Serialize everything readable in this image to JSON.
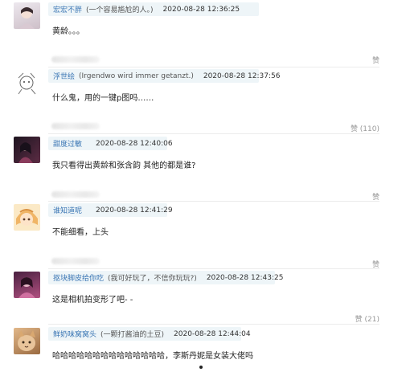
{
  "comments": [
    {
      "username": "宏宏不胖",
      "status": "(一个容易尴尬的人。)",
      "time": "2020-08-28 12:36:25",
      "text": "黄龄。。。",
      "likes": "赞",
      "avatar_colors": [
        "#e9e4ea",
        "#c9b9c2"
      ]
    },
    {
      "username": "浮世绘",
      "status": "(Irgendwo wird immer getanzt.)",
      "time": "2020-08-28 12:37:56",
      "text": "什么鬼，用的一键p图吗……",
      "likes": "赞 (110)",
      "avatar_colors": [
        "#ffffff",
        "#555555"
      ]
    },
    {
      "username": "甜度过敏",
      "status": "",
      "time": "2020-08-28 12:40:06",
      "text": "我只看得出黄龄和张含韵 其他的都是谁?",
      "likes": "赞",
      "avatar_colors": [
        "#2a1e28",
        "#7a3c55"
      ]
    },
    {
      "username": "谁知道呢",
      "status": "",
      "time": "2020-08-28 12:41:29",
      "text": "不能细看，上头",
      "likes": "赞",
      "avatar_colors": [
        "#f3d9a4",
        "#c98a5a"
      ]
    },
    {
      "username": "抠块脚皮给你吃",
      "status": "(我可好玩了，不信你玩玩?)",
      "time": "2020-08-28 12:43:25",
      "text": "这是相机拍变形了吧- -",
      "likes": "赞 (21)",
      "avatar_colors": [
        "#5a2a4a",
        "#c45a8a"
      ]
    },
    {
      "username": "鲜奶味窝窝头",
      "status": "(一颗打酱油的土豆)",
      "time": "2020-08-28 12:44:04",
      "text": "哈哈哈哈哈哈哈哈哈哈哈哈哈哈，李斯丹妮是女装大佬吗",
      "likes": "",
      "avatar_colors": [
        "#d7a878",
        "#8a5a32"
      ]
    }
  ]
}
